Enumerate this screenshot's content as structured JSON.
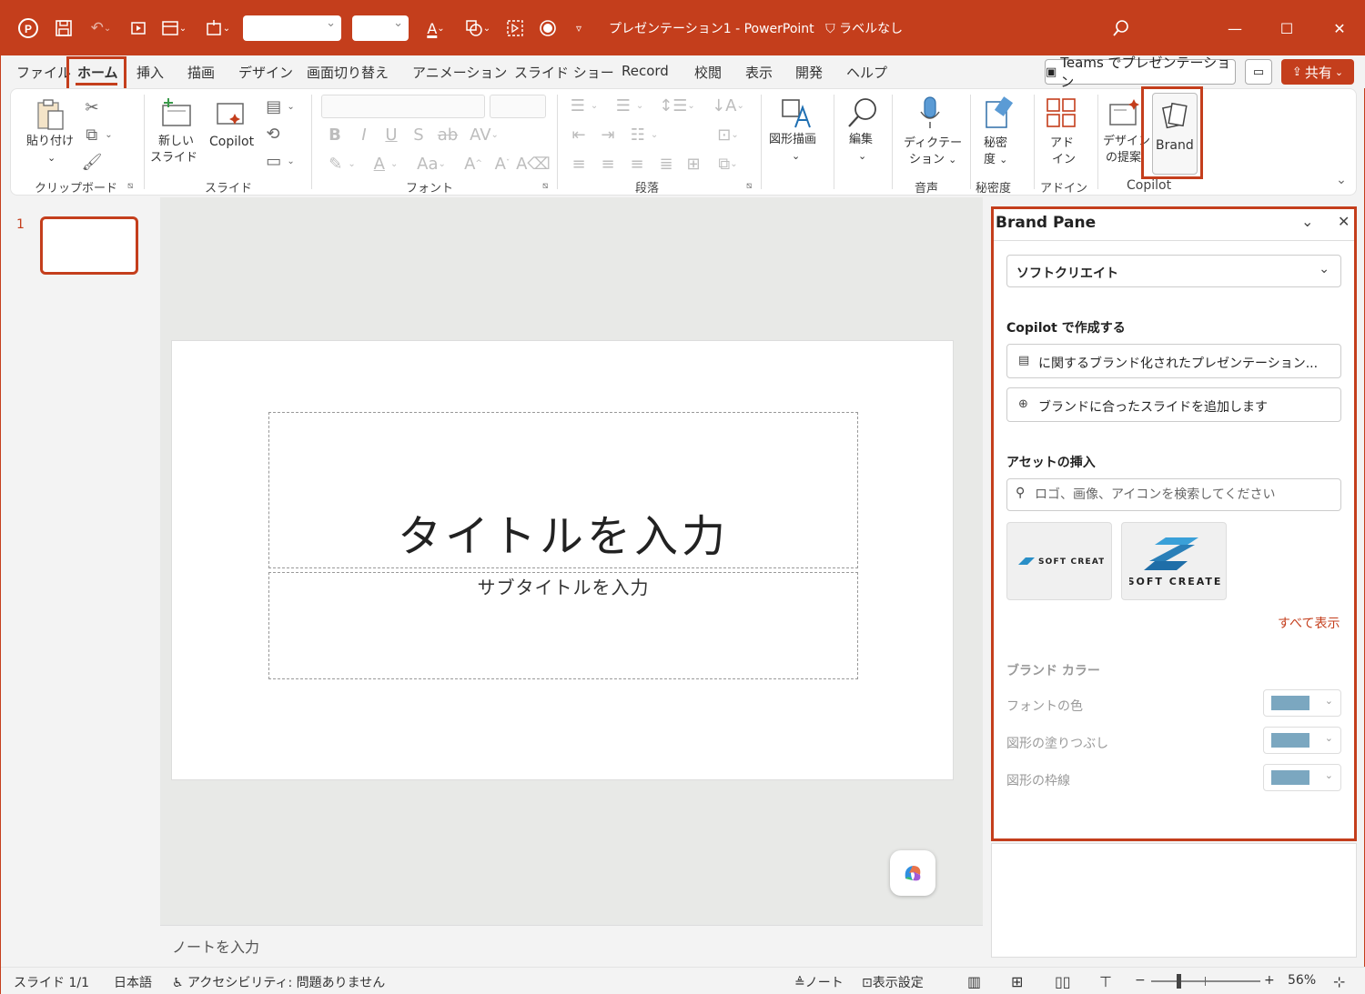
{
  "app": {
    "doc_title": "プレゼンテーション1  -  PowerPoint",
    "label": "ラベルなし"
  },
  "tabs": [
    {
      "label": "ファイル"
    },
    {
      "label": "ホーム"
    },
    {
      "label": "挿入"
    },
    {
      "label": "描画"
    },
    {
      "label": "デザイン"
    },
    {
      "label": "画面切り替え"
    },
    {
      "label": "アニメーション"
    },
    {
      "label": "スライド ショー"
    },
    {
      "label": "Record"
    },
    {
      "label": "校閲"
    },
    {
      "label": "表示"
    },
    {
      "label": "開発"
    },
    {
      "label": "ヘルプ"
    }
  ],
  "header_buttons": {
    "teams": "Teams でプレゼンテーション",
    "share": "共有"
  },
  "ribbon": {
    "paste": "貼り付け",
    "new_slide_1": "新しい",
    "new_slide_2": "スライド",
    "copilot": "Copilot",
    "draw_shapes": "図形描画",
    "edit": "編集",
    "dictate_1": "ディクテー",
    "dictate_2": "ション",
    "sensitivity_1": "秘密",
    "sensitivity_2": "度",
    "addins_1": "アド",
    "addins_2": "イン",
    "designer_1": "デザイン",
    "designer_2": "の提案",
    "brand": "Brand",
    "groups": {
      "clipboard": "クリップボード",
      "slides": "スライド",
      "font": "フォント",
      "paragraph": "段落",
      "voice": "音声",
      "sensitivity": "秘密度",
      "addins": "アドイン",
      "copilot": "Copilot"
    }
  },
  "thumbnail": {
    "number": "1"
  },
  "slide": {
    "title_placeholder": "タイトルを入力",
    "subtitle_placeholder": "サブタイトルを入力"
  },
  "notes": {
    "placeholder": "ノートを入力"
  },
  "brand_pane": {
    "title": "Brand Pane",
    "brand_selected": "ソフトクリエイト",
    "copilot_heading": "Copilot で作成する",
    "action_1": "に関するブランド化されたプレゼンテーション...",
    "action_2": "ブランドに合ったスライドを追加します",
    "assets_heading": "アセットの挿入",
    "search_placeholder": "ロゴ、画像、アイコンを検索してください",
    "logo_1_text": "SOFT CREATE",
    "logo_2_text": "SOFT CREATE",
    "see_all": "すべて表示",
    "colors_heading": "ブランド カラー",
    "color_rows": [
      {
        "label": "フォントの色"
      },
      {
        "label": "図形の塗りつぶし"
      },
      {
        "label": "図形の枠線"
      }
    ],
    "swatch_color": "#7ba7c0"
  },
  "status": {
    "slide": "スライド 1/1",
    "language": "日本語",
    "accessibility": "アクセシビリティ: 問題ありません",
    "notes": "ノート",
    "display_settings": "表示設定",
    "zoom": "56%"
  },
  "colors": {
    "accent": "#c43e1c"
  }
}
